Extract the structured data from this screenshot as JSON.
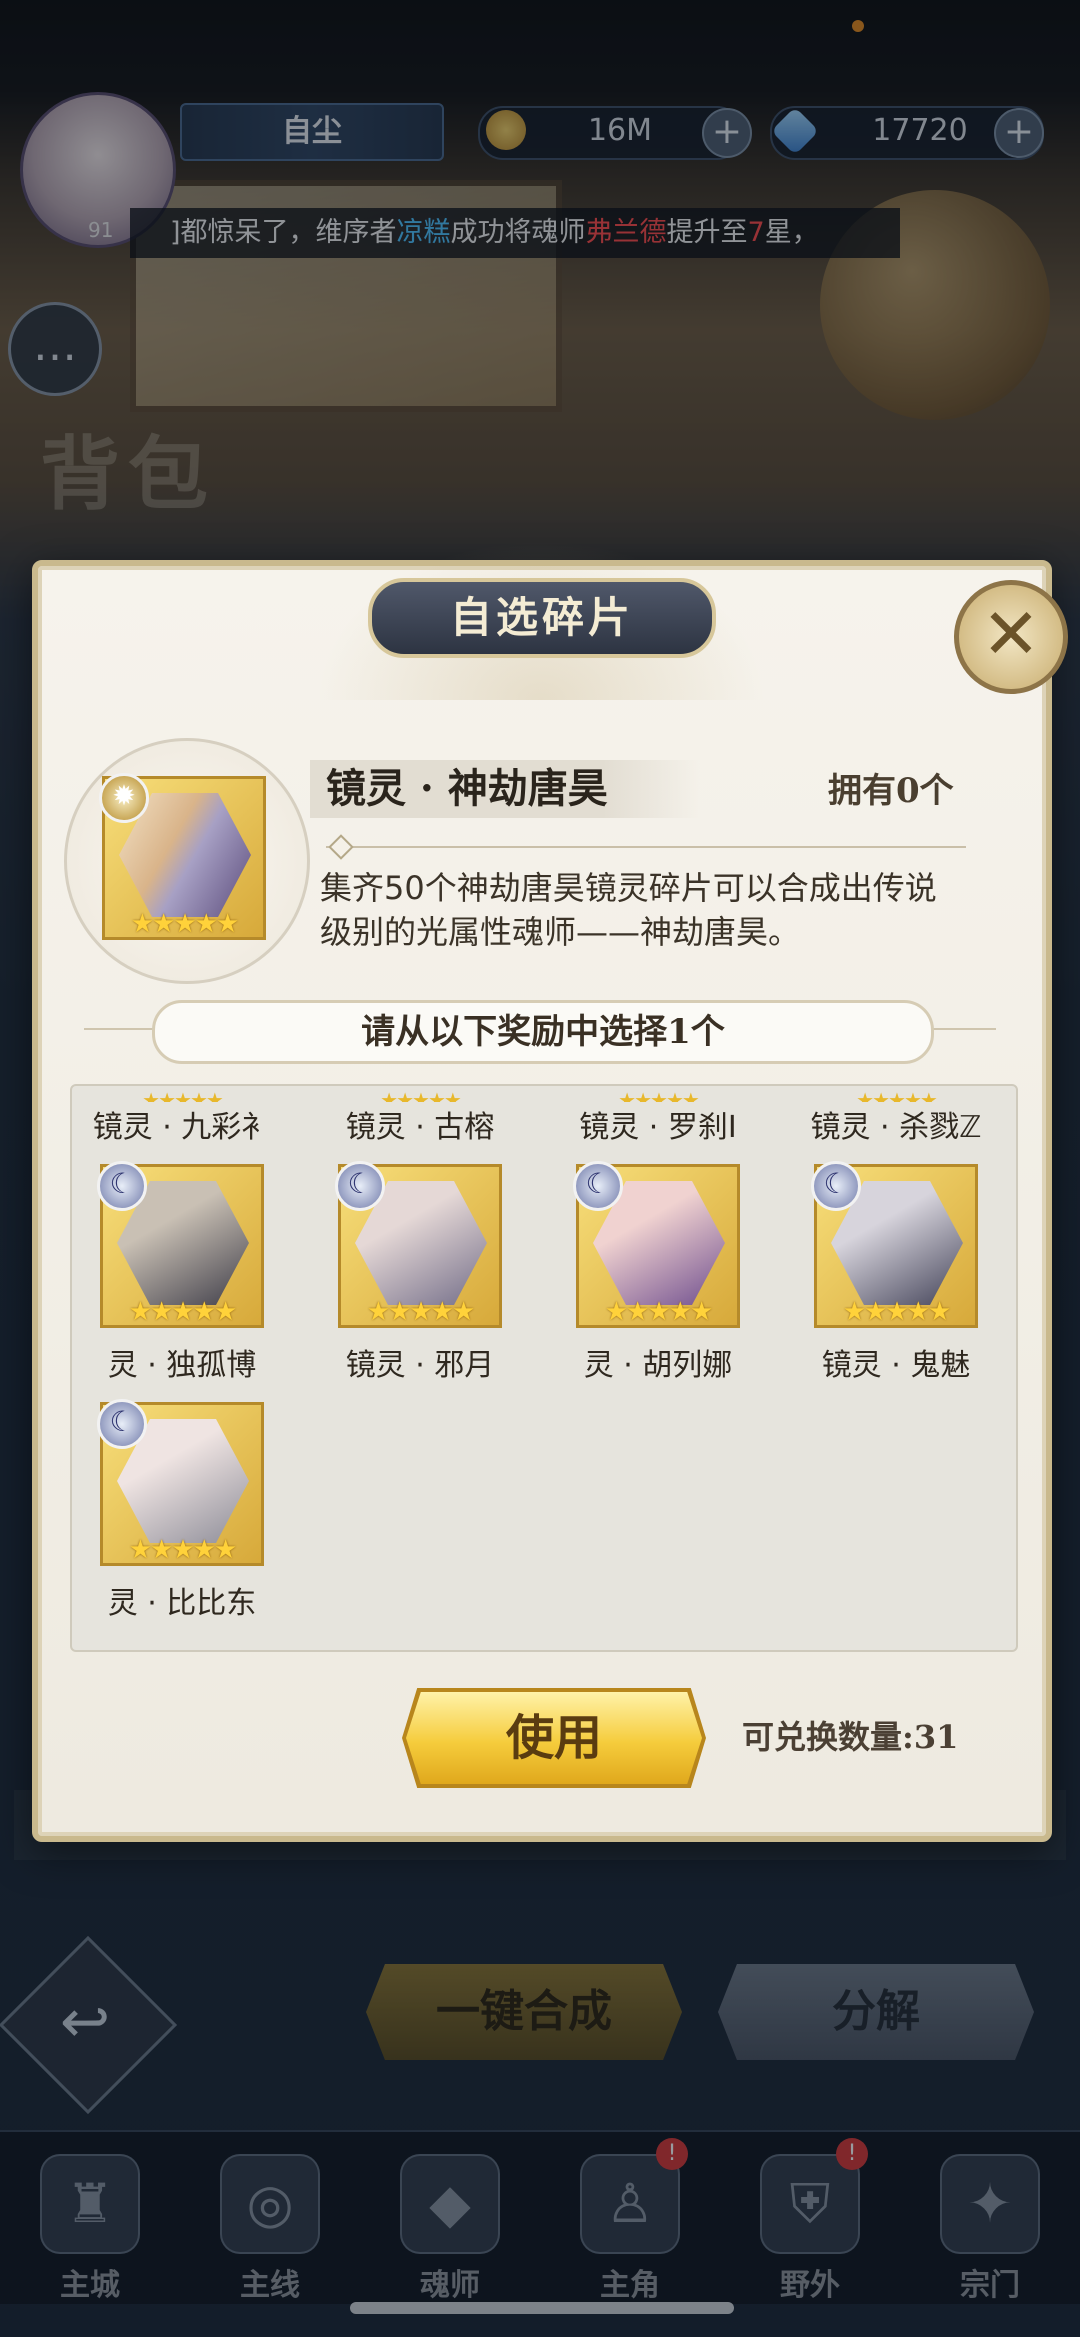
{
  "header": {
    "player_name": "自尘",
    "gold": "16M",
    "diamonds": "17720",
    "level": "91"
  },
  "ticker": {
    "part1": "]都惊呆了，维序者",
    "player": "凉糕",
    "part2": "成功将魂师",
    "hero": "弗兰德",
    "part3": "提升至",
    "star": "7",
    "part4": "星，"
  },
  "page": {
    "title": "背包"
  },
  "dialog": {
    "title": "自选碎片",
    "hero_name": "镜灵 · 神劫唐昊",
    "owned": "拥有0个",
    "description": "集齐50个神劫唐昊镜灵碎片可以合成出传说级别的光属性魂师——神劫唐昊。",
    "select_prompt": "请从以下奖励中选择1个",
    "use_label": "使用",
    "exchange_count": "可兑换数量:31",
    "top_row_labels": [
      "镜灵 · 九彩衤",
      "镜灵 · 古榕",
      "镜灵 · 罗刹Ⅰ",
      "镜灵 · 杀戮ℤ"
    ],
    "options": [
      {
        "label": "灵 · 独孤博",
        "palette": [
          "#3b3a46",
          "#c9c0b4"
        ]
      },
      {
        "label": "镜灵 · 邪月",
        "palette": [
          "#6f6a86",
          "#e5d8d6"
        ]
      },
      {
        "label": "灵 · 胡列娜",
        "palette": [
          "#6b4a8c",
          "#f0d2d0"
        ]
      },
      {
        "label": "镜灵 · 鬼魅",
        "palette": [
          "#3f3f55",
          "#d7d4dc"
        ]
      },
      {
        "label": "灵 · 比比东",
        "palette": [
          "#8a8a96",
          "#efe4e2"
        ]
      }
    ]
  },
  "actions": {
    "merge_label": "一键合成",
    "decompose_label": "分解"
  },
  "nav": [
    {
      "label": "主城",
      "icon": "castle-icon",
      "badge": ""
    },
    {
      "label": "主线",
      "icon": "mainline-icon",
      "badge": ""
    },
    {
      "label": "魂师",
      "icon": "soul-master-icon",
      "badge": ""
    },
    {
      "label": "主角",
      "icon": "hero-icon",
      "badge": "!"
    },
    {
      "label": "野外",
      "icon": "wild-icon",
      "badge": "!"
    },
    {
      "label": "宗门",
      "icon": "sect-icon",
      "badge": ""
    }
  ],
  "colors": {
    "gold_accent": "#f5cc3c",
    "ticker_blue": "#4fc3ff",
    "ticker_red": "#ff4a4a"
  }
}
